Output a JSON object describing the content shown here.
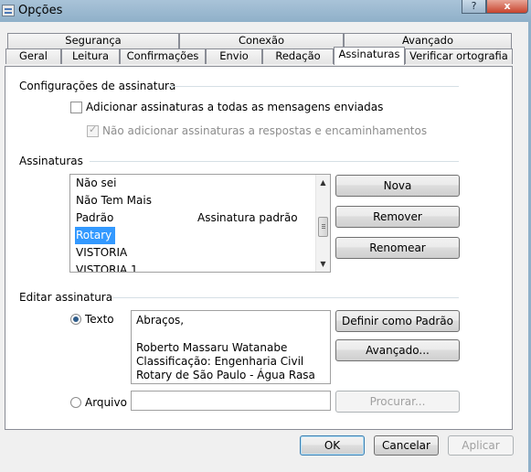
{
  "window": {
    "title": "Opções",
    "help_label": "?",
    "close_label": "x"
  },
  "tabs_top": [
    "Segurança",
    "Conexão",
    "Avançado"
  ],
  "tabs_bottom": [
    "Geral",
    "Leitura",
    "Confirmações",
    "Envio",
    "Redação",
    "Assinaturas",
    "Verificar ortografia"
  ],
  "active_tab": "Assinaturas",
  "settings": {
    "heading": "Configurações de assinatura",
    "add_all_label": "Adicionar assinaturas a todas as mensagens enviadas",
    "add_all_checked": false,
    "no_reply_label": "Não adicionar assinaturas a respostas e encaminhamentos",
    "no_reply_checked": true,
    "no_reply_enabled": false
  },
  "signatures": {
    "heading": "Assinaturas",
    "items": [
      {
        "name": "Não sei",
        "note": ""
      },
      {
        "name": "Não Tem Mais",
        "note": ""
      },
      {
        "name": "Padrão",
        "note": "Assinatura padrão"
      },
      {
        "name": "Rotary",
        "note": "",
        "selected": true
      },
      {
        "name": "VISTORIA",
        "note": ""
      },
      {
        "name": "VISTORIA 1",
        "note": ""
      }
    ],
    "new_label": "Nova",
    "remove_label": "Remover",
    "rename_label": "Renomear"
  },
  "edit": {
    "heading": "Editar assinatura",
    "text_label": "Texto",
    "text_selected": true,
    "text_lines": [
      "Abraços,",
      "",
      "Roberto Massaru Watanabe",
      "Classificação: Engenharia Civil",
      "Rotary de São Paulo - Água Rasa"
    ],
    "set_default_label": "Definir como Padrão",
    "advanced_label": "Avançado...",
    "file_label": "Arquivo",
    "file_value": "",
    "browse_label": "Procurar..."
  },
  "footer": {
    "ok_label": "OK",
    "cancel_label": "Cancelar",
    "apply_label": "Aplicar"
  }
}
